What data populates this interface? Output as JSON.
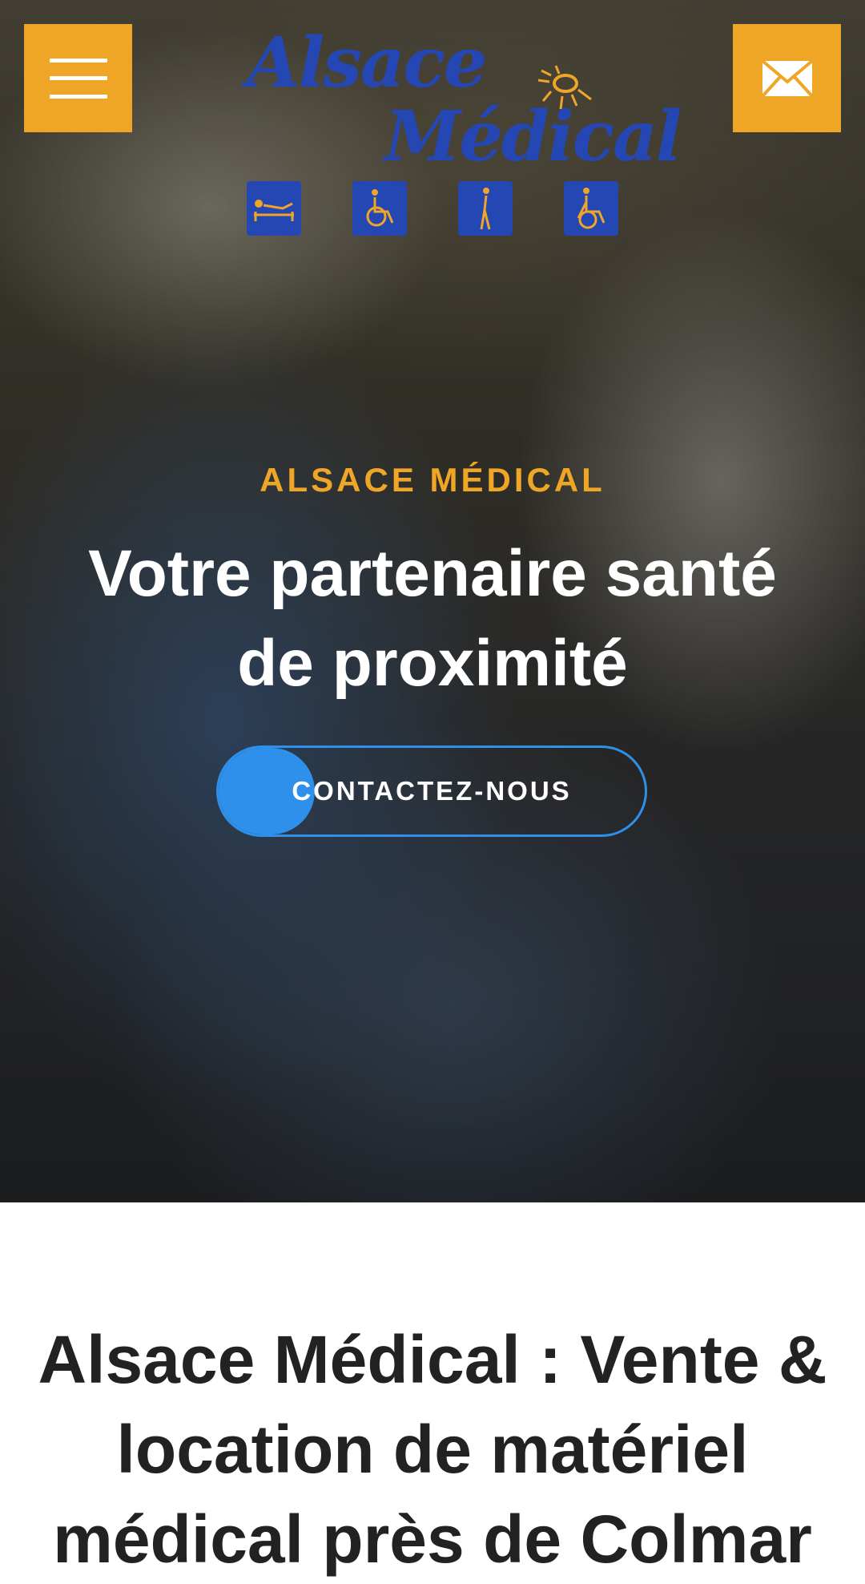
{
  "header": {
    "menu_icon": "hamburger-menu-icon",
    "mail_icon": "envelope-icon",
    "logo": {
      "line1": "Alsace",
      "line2": "Médical",
      "icons": [
        "bed-icon",
        "wheelchair-icon",
        "walking-person-icon",
        "wheelchair-pusher-icon"
      ]
    }
  },
  "hero": {
    "eyebrow": "ALSACE MÉDICAL",
    "headline": "Votre partenaire santé de proximité",
    "cta_label": "CONTACTEZ-NOUS"
  },
  "content": {
    "title": "Alsace Médical : Vente & location de matériel médical près de Colmar"
  },
  "colors": {
    "accent_orange": "#efa525",
    "brand_blue": "#2547b3",
    "cta_blue": "#2e90ea"
  }
}
